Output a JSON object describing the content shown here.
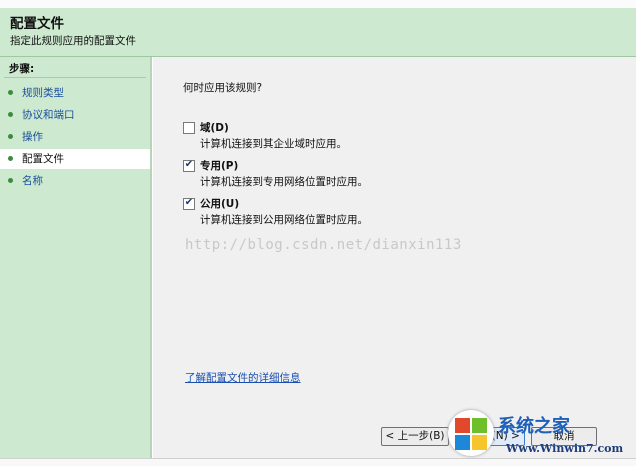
{
  "header": {
    "title": "配置文件",
    "subtitle": "指定此规则应用的配置文件"
  },
  "sidebar": {
    "steps_label": "步骤:",
    "items": [
      {
        "label": "规则类型",
        "active": false
      },
      {
        "label": "协议和端口",
        "active": false
      },
      {
        "label": "操作",
        "active": false
      },
      {
        "label": "配置文件",
        "active": true
      },
      {
        "label": "名称",
        "active": false
      }
    ]
  },
  "main": {
    "question": "何时应用该规则?",
    "options": [
      {
        "title": "域(D)",
        "description": "计算机连接到其企业域时应用。",
        "checked": false
      },
      {
        "title": "专用(P)",
        "description": "计算机连接到专用网络位置时应用。",
        "checked": true
      },
      {
        "title": "公用(U)",
        "description": "计算机连接到公用网络位置时应用。",
        "checked": true
      }
    ],
    "learn_more": "了解配置文件的详细信息"
  },
  "buttons": {
    "back": "< 上一步(B)",
    "next": "下一步(N) >",
    "cancel": "取消"
  },
  "watermark": "http://blog.csdn.net/dianxin113",
  "site_logo": {
    "brand": "系统之家",
    "url": "Www.Winwin7.com"
  },
  "colors": {
    "header_bg": "#cde9cf",
    "sidebar_bg": "#cde9cf",
    "link": "#1a4fb0",
    "bullet": "#3d8a3f"
  }
}
